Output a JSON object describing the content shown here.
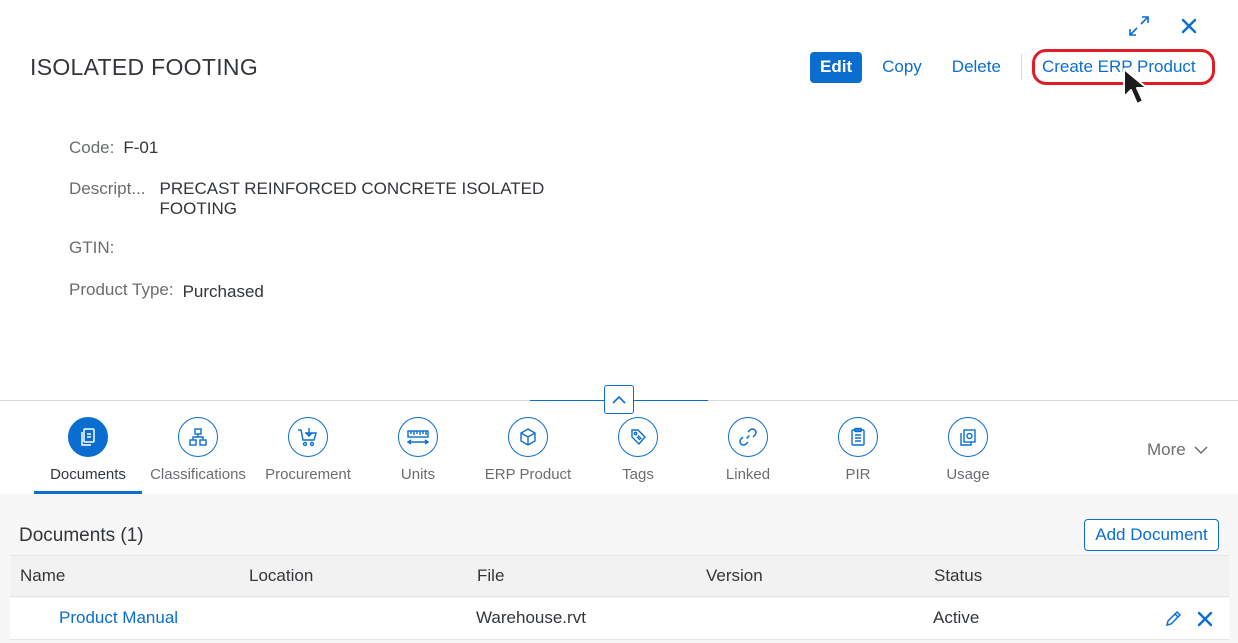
{
  "header": {
    "title": "ISOLATED FOOTING",
    "icons": {
      "fullscreen": "exit-fullscreen-icon",
      "close": "close-icon"
    }
  },
  "actions": {
    "edit": "Edit",
    "copy": "Copy",
    "delete": "Delete",
    "create_erp": "Create ERP Product"
  },
  "fields": {
    "code": {
      "label": "Code:",
      "value": "F-01"
    },
    "description": {
      "label": "Descript...",
      "value_line1": "PRECAST REINFORCED CONCRETE ISOLATED",
      "value_line2": "FOOTING"
    },
    "gtin": {
      "label": "GTIN:",
      "value": ""
    },
    "product_type": {
      "label": "Product Type:",
      "value": "Purchased"
    }
  },
  "tabs": [
    {
      "label": "Documents",
      "icon": "documents-icon",
      "active": true
    },
    {
      "label": "Classifications",
      "icon": "hierarchy-icon",
      "active": false
    },
    {
      "label": "Procurement",
      "icon": "cart-icon",
      "active": false
    },
    {
      "label": "Units",
      "icon": "ruler-icon",
      "active": false
    },
    {
      "label": "ERP Product",
      "icon": "product-box-icon",
      "active": false
    },
    {
      "label": "Tags",
      "icon": "tag-icon",
      "active": false
    },
    {
      "label": "Linked",
      "icon": "link-icon",
      "active": false
    },
    {
      "label": "PIR",
      "icon": "clipboard-icon",
      "active": false
    },
    {
      "label": "Usage",
      "icon": "usage-icon",
      "active": false
    }
  ],
  "more": "More",
  "documents": {
    "title": "Documents (1)",
    "add_button": "Add Document",
    "columns": [
      "Name",
      "Location",
      "File",
      "Version",
      "Status"
    ],
    "rows": [
      {
        "name": "Product Manual",
        "location": "",
        "file": "Warehouse.rvt",
        "version": "",
        "status": "Active"
      }
    ]
  },
  "colors": {
    "accent": "#0a6ed1",
    "highlight": "#e11c27",
    "text": "#32363a",
    "muted": "#6a6d70"
  }
}
